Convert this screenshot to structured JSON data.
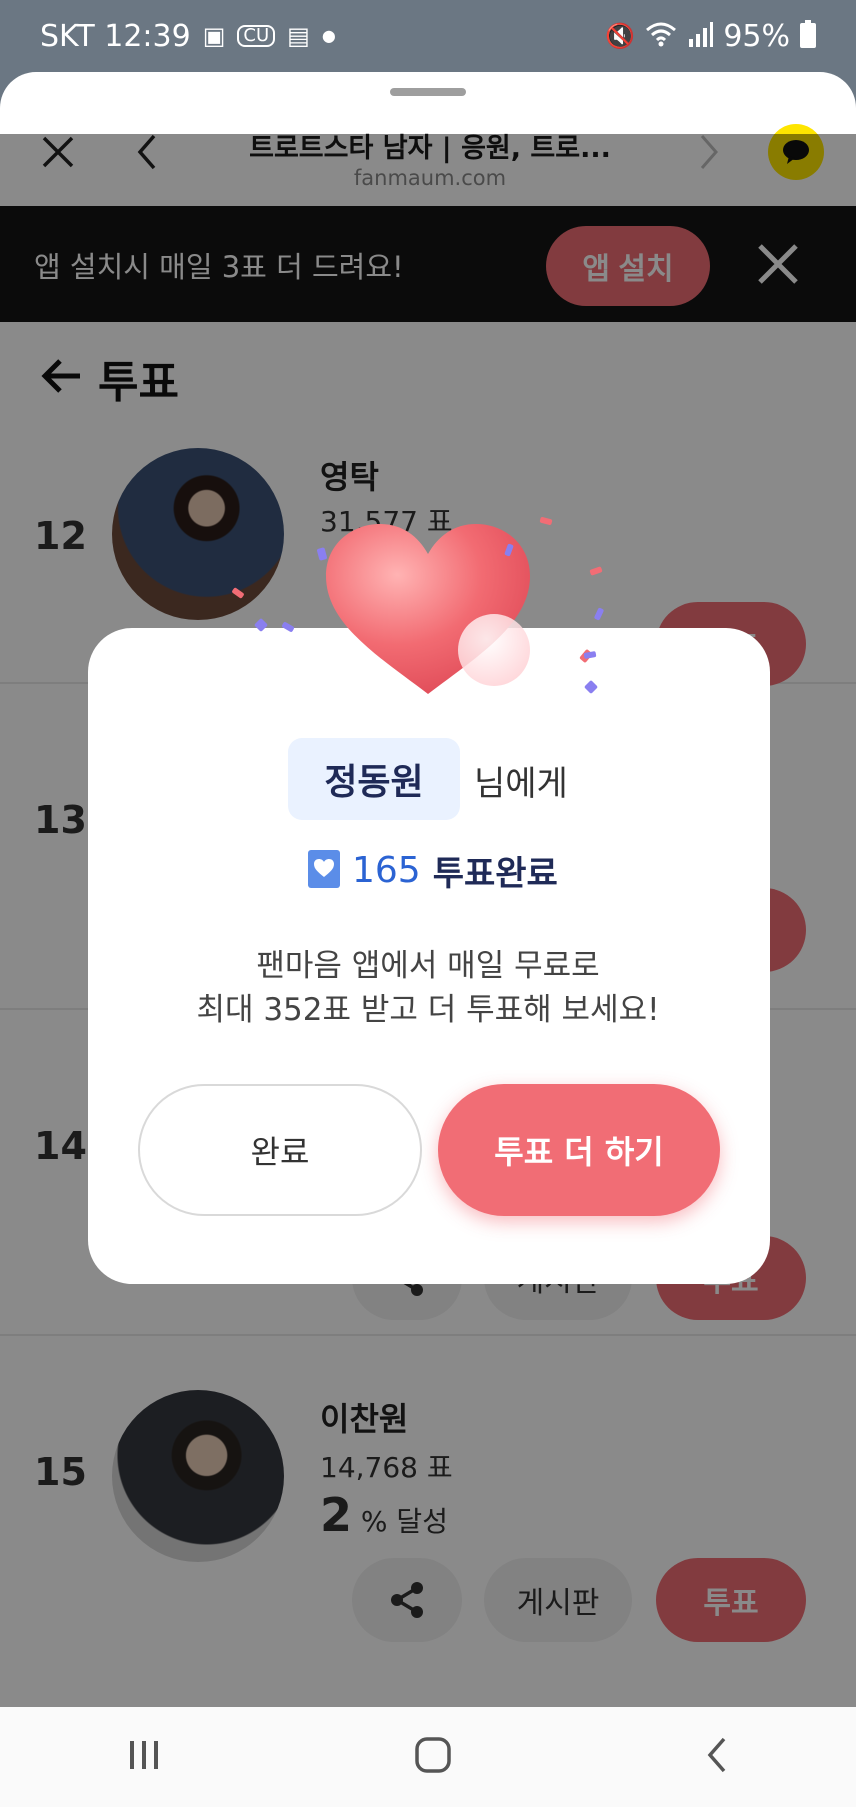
{
  "status_bar": {
    "carrier_time": "SKT 12:39",
    "battery": "95%",
    "left_icons": [
      "image-icon",
      "cu-icon",
      "calendar-icon",
      "dot-icon"
    ],
    "right_icons": [
      "mute-icon",
      "wifi-icon",
      "signal-icon",
      "battery-icon"
    ]
  },
  "browser": {
    "title": "트로트스타 남자 | 응원, 트로...",
    "url": "fanmaum.com"
  },
  "banner": {
    "text": "앱 설치시 매일 3표 더 드려요!",
    "install_label": "앱 설치"
  },
  "page": {
    "title": "투표",
    "rows": [
      {
        "rank": "12",
        "name": "영탁",
        "votes": "31,577 표"
      },
      {
        "rank": "13"
      },
      {
        "rank": "14"
      },
      {
        "rank": "15",
        "name": "이찬원",
        "votes": "14,768 표",
        "pct_value": "2",
        "pct_suffix": "% 달성"
      }
    ],
    "board_label": "게시판",
    "vote_label": "투표"
  },
  "modal": {
    "recipient": "정동원",
    "recipient_suffix": "님에게",
    "vote_count": "165",
    "vote_done": "투표완료",
    "message_line1": "팬마음 앱에서 매일 무료로",
    "message_line2": "최대 352표 받고 더 투표해 보세요!",
    "complete_label": "완료",
    "more_label": "투표 더 하기"
  },
  "colors": {
    "accent": "#f16d75",
    "kakao": "#fee500",
    "vote_count": "#2b63d3",
    "recipient_bg": "#eaf2ff"
  }
}
